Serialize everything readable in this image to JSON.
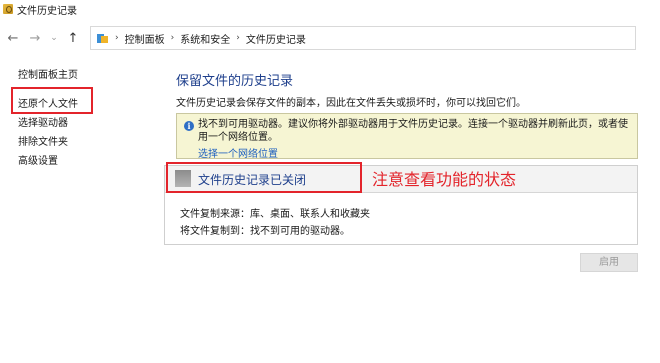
{
  "window": {
    "title": "文件历史记录"
  },
  "address": {
    "breadcrumbs": [
      "控制面板",
      "系统和安全",
      "文件历史记录"
    ],
    "icons": {
      "back": "back-arrow",
      "forward": "forward-arrow",
      "recent": "chevron-down",
      "up": "up-arrow",
      "location": "control-panel-icon"
    }
  },
  "sidebar": {
    "items": [
      {
        "label": "控制面板主页"
      },
      {
        "label": "还原个人文件"
      },
      {
        "label": "选择驱动器"
      },
      {
        "label": "排除文件夹"
      },
      {
        "label": "高级设置"
      }
    ]
  },
  "main": {
    "heading": "保留文件的历史记录",
    "description": "文件历史记录会保存文件的副本，因此在文件丢失或损坏时，你可以找回它们。",
    "warning": {
      "icon": "info-icon",
      "text": "找不到可用驱动器。建议你将外部驱动器用于文件历史记录。连接一个驱动器并刷新此页，或者使用一个网络位置。",
      "link": "选择一个网络位置"
    },
    "status": {
      "title": "文件历史记录已关闭",
      "copy_from_label": "文件复制来源：",
      "copy_from_value": "库、桌面、联系人和收藏夹",
      "copy_to_label": "将文件复制到：",
      "copy_to_value": "找不到可用的驱动器。"
    },
    "enable_button": "启用"
  },
  "annotation": {
    "text": "注意查看功能的状态",
    "color": "#e3242b"
  }
}
